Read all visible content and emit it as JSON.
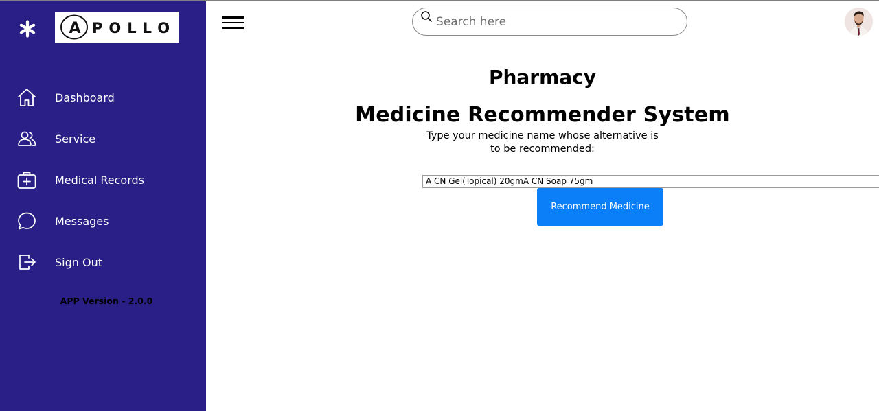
{
  "brand": {
    "star_icon": "asterisk-icon",
    "logo_text": "APOLLO"
  },
  "sidebar": {
    "items": [
      {
        "label": "Dashboard",
        "icon": "home-icon"
      },
      {
        "label": "Service",
        "icon": "users-icon"
      },
      {
        "label": "Medical Records",
        "icon": "medical-kit-icon"
      },
      {
        "label": "Messages",
        "icon": "chat-bubble-icon"
      },
      {
        "label": "Sign Out",
        "icon": "sign-out-icon"
      }
    ],
    "version": "APP Version - 2.0.0"
  },
  "header": {
    "menu_icon": "hamburger-icon",
    "search": {
      "placeholder": "Search here",
      "value": "",
      "icon": "search-icon"
    },
    "avatar_icon": "user-avatar"
  },
  "main": {
    "heading": "Pharmacy",
    "title": "Medicine Recommender System",
    "instructions": "Type your medicine name whose alternative is to be recommended:",
    "selected_medicine": "A CN Gel(Topical) 20gmA CN Soap 75gm",
    "button_label": "Recommend Medicine"
  },
  "colors": {
    "sidebar_bg": "#2a1f87",
    "button_bg": "#0a7ff7",
    "text_white": "#ffffff"
  }
}
